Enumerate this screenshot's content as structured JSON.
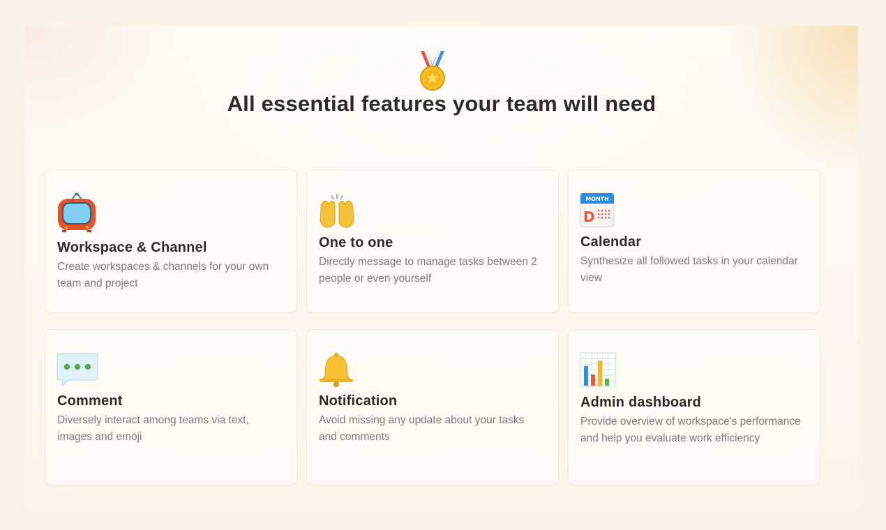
{
  "hero": {
    "title": "All essential features your team will need",
    "icon": "medal-icon"
  },
  "features": [
    {
      "icon": "television-icon",
      "title": "Workspace & Channel",
      "description": "Create workspaces & channels for your own team and project"
    },
    {
      "icon": "raising-hands-icon",
      "title": "One to one",
      "description": "Directly message to manage tasks between 2 people or even yourself"
    },
    {
      "icon": "calendar-icon",
      "title": "Calendar",
      "description": "Synthesize all followed tasks in your calendar view",
      "icon_text": {
        "header": "MONTH",
        "letter": "D"
      }
    },
    {
      "icon": "speech-bubble-icon",
      "title": "Comment",
      "description": "Diversely interact among teams via text, images and emoji"
    },
    {
      "icon": "bell-icon",
      "title": "Notification",
      "description": "Avoid missing any update about your tasks and comments"
    },
    {
      "icon": "bar-chart-icon",
      "title": "Admin dashboard",
      "description": "Provide overview of workspace's performance and help you evaluate work efficiency"
    }
  ],
  "colors": {
    "background": "#fcf3e8",
    "title": "#2b2b2b",
    "description": "#7b7b7b"
  }
}
